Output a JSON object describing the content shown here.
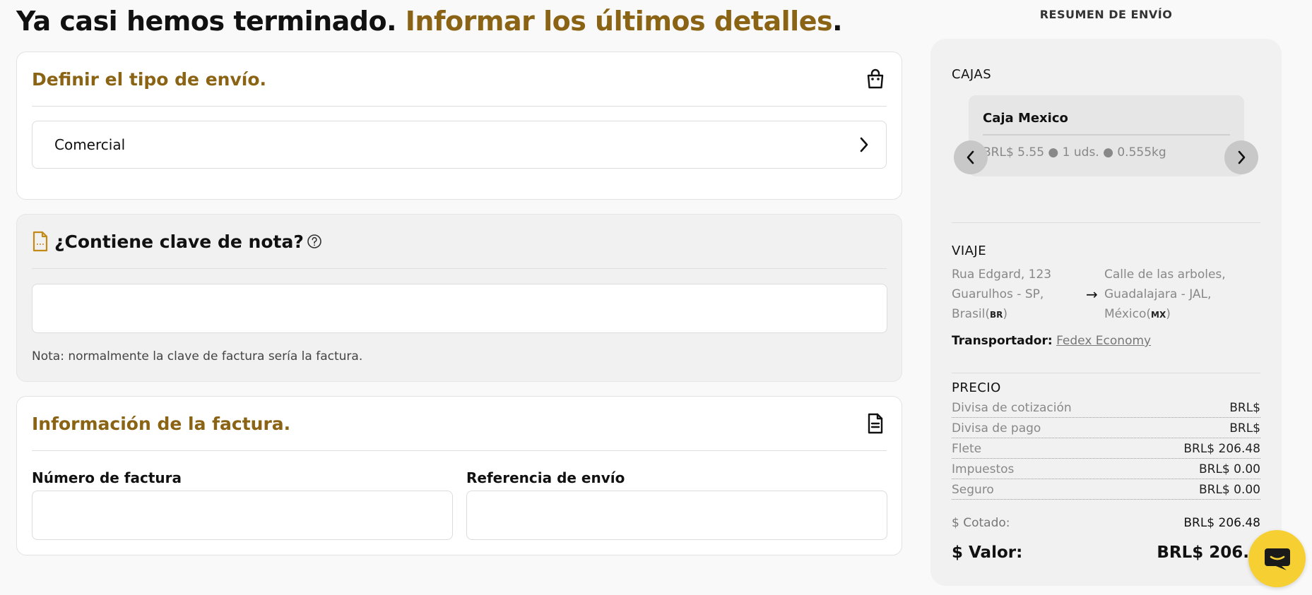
{
  "title": {
    "part1": "Ya casi hemos terminado.",
    "part2": "Informar los últimos detalles",
    "part3": "."
  },
  "shipping_type": {
    "title": "Definir el tipo de envío.",
    "icon": "shopping-bag-icon",
    "selected": "Comercial"
  },
  "note_key": {
    "title": "¿Contiene clave de nota?",
    "input_value": "",
    "note": "Nota: normalmente la clave de factura sería la factura."
  },
  "invoice": {
    "title": "Información de la factura.",
    "number_label": "Número de factura",
    "number_value": "",
    "reference_label": "Referencia de envío",
    "reference_value": ""
  },
  "summary": {
    "title": "RESUMEN DE ENVÍO",
    "boxes_label": "CAJAS",
    "box": {
      "name": "Caja Mexico",
      "meta": "BRL$ 5.55 ● 1 uds. ● 0.555kg"
    },
    "trip_label": "VIAJE",
    "origin": {
      "line1": "Rua Edgard, 123",
      "line2": "Guarulhos - SP,",
      "line3": "Brasil(",
      "cc": "BR",
      "close": ")"
    },
    "destination": {
      "line1": "Calle de las arboles,",
      "line2": "Guadalajara - JAL,",
      "line3": "México(",
      "cc": "MX",
      "close": ")"
    },
    "carrier_label": "Transportador:",
    "carrier_value": "Fedex Economy",
    "price_label": "PRECIO",
    "prices": [
      {
        "label": "Divisa de cotización",
        "value": "BRL$"
      },
      {
        "label": "Divisa de pago",
        "value": "BRL$"
      },
      {
        "label": "Flete",
        "value": "BRL$ 206.48"
      },
      {
        "label": "Impuestos",
        "value": "BRL$ 0.00"
      },
      {
        "label": "Seguro",
        "value": "BRL$ 0.00"
      }
    ],
    "quoted_label": "$ Cotado:",
    "quoted_value": "BRL$ 206.48",
    "total_label": "$ Valor:",
    "total_value": "BRL$ 206.4"
  },
  "colors": {
    "accent": "#8a6314",
    "chat": "#f6d032"
  }
}
